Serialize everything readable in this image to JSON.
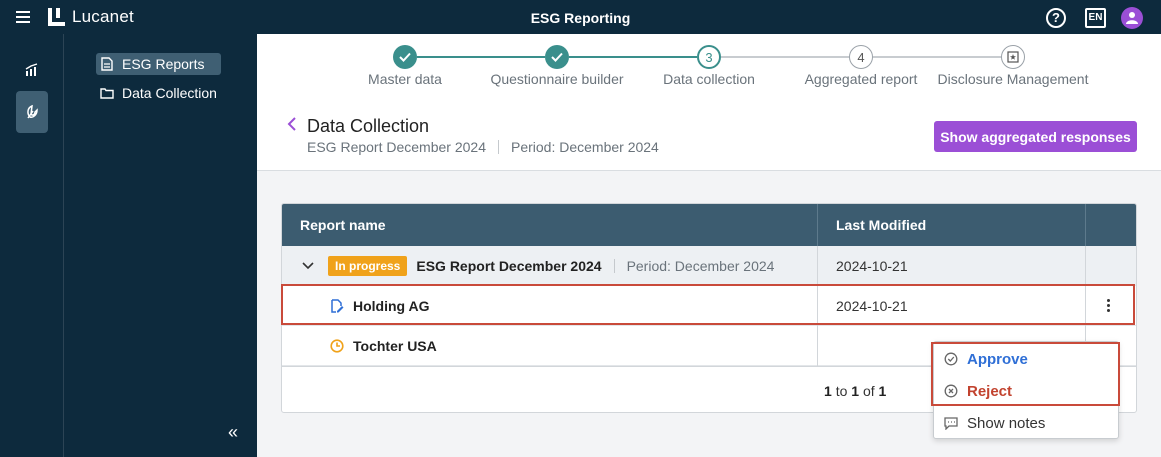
{
  "app": {
    "logo_text": "Lucanet",
    "title": "ESG Reporting",
    "lang": "EN",
    "help": "?"
  },
  "nav": {
    "items": [
      {
        "label": "ESG Reports",
        "icon": "document-icon",
        "active": true
      },
      {
        "label": "Data Collection",
        "icon": "folder-icon",
        "active": false
      }
    ],
    "collapse": "«"
  },
  "stepper": {
    "steps": [
      {
        "label": "Master data",
        "state": "done",
        "number": ""
      },
      {
        "label": "Questionnaire builder",
        "state": "done",
        "number": ""
      },
      {
        "label": "Data collection",
        "state": "current",
        "number": "3"
      },
      {
        "label": "Aggregated report",
        "state": "todo",
        "number": "4"
      },
      {
        "label": "Disclosure Management",
        "state": "todo",
        "number": ""
      }
    ]
  },
  "page": {
    "title": "Data Collection",
    "report": "ESG Report December 2024",
    "period": "Period: December 2024",
    "primary_button": "Show aggregated responses"
  },
  "table": {
    "columns": [
      "Report name",
      "Last Modified"
    ],
    "group": {
      "status": "In progress",
      "name": "ESG Report December 2024",
      "period": "Period: December 2024",
      "modified": "2024-10-21"
    },
    "rows": [
      {
        "name": "Holding AG",
        "icon": "document-edit-icon",
        "modified": "2024-10-21"
      },
      {
        "name": "Tochter USA",
        "icon": "clock-icon",
        "modified": ""
      }
    ],
    "pager": {
      "from": "1",
      "to_word": "to",
      "to": "1",
      "of_word": "of",
      "total": "1"
    }
  },
  "menu": {
    "items": [
      {
        "label": "Approve"
      },
      {
        "label": "Reject"
      },
      {
        "label": "Show notes"
      }
    ]
  },
  "colors": {
    "accent": "#9b4fd6",
    "teal": "#3a8f8c",
    "nav_bg": "#0d2a3d",
    "status": "#f0a21a",
    "approve": "#2f6fd6",
    "reject": "#c2432f"
  }
}
